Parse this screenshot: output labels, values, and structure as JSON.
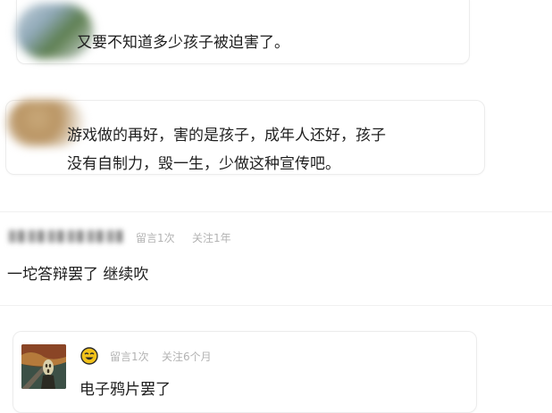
{
  "comments": [
    {
      "text": "又要不知道多少孩子被迫害了。"
    },
    {
      "line1": "游戏做的再好，害的是孩子，成年人还好，孩子",
      "line2": "没有自制力，毁一生，少做这种宣传吧。"
    },
    {
      "meta_comments": "留言1次",
      "meta_follow": "关注1年",
      "text": "一坨答辩罢了 继续吹"
    },
    {
      "meta_comments": "留言1次",
      "meta_follow": "关注6个月",
      "text": "电子鸦片罢了",
      "badge_icon": "emoji-face-icon"
    }
  ],
  "colors": {
    "meta": "#b3b3b3",
    "text": "#1f1f1f",
    "badge": "#f2c21b"
  }
}
